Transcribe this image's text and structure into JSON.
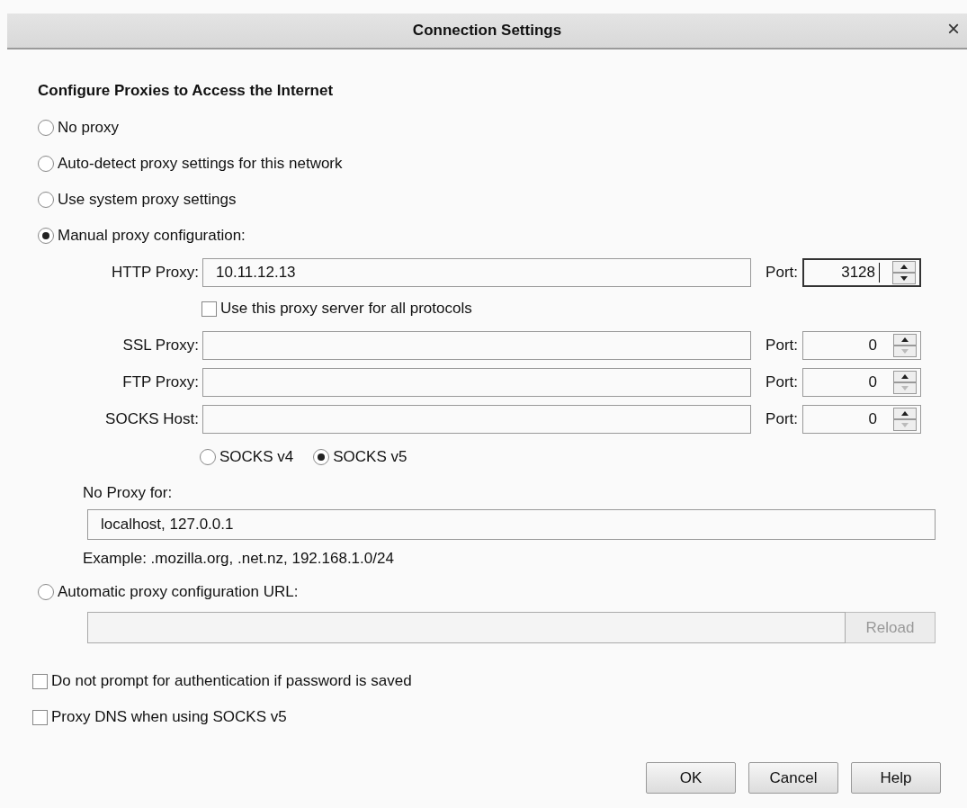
{
  "window": {
    "title": "Connection Settings",
    "close": "×"
  },
  "heading": "Configure Proxies to Access the Internet",
  "proxy_modes": [
    {
      "label": "No proxy",
      "selected": false
    },
    {
      "label": "Auto-detect proxy settings for this network",
      "selected": false
    },
    {
      "label": "Use system proxy settings",
      "selected": false
    },
    {
      "label": "Manual proxy configuration:",
      "selected": true
    }
  ],
  "manual": {
    "http": {
      "label": "HTTP Proxy:",
      "value": "10.11.12.13",
      "port_label": "Port:",
      "port": "3128",
      "focused": true,
      "down_disabled": false
    },
    "share_all": {
      "label": "Use this proxy server for all protocols",
      "checked": false
    },
    "other_proxies": [
      {
        "label": "SSL Proxy:",
        "port_label": "Port:",
        "port": "0",
        "focused": false,
        "down_disabled": true
      },
      {
        "label": "FTP Proxy:",
        "port_label": "Port:",
        "port": "0",
        "focused": false,
        "down_disabled": true
      },
      {
        "label": "SOCKS Host:",
        "port_label": "Port:",
        "port": "0",
        "focused": false,
        "down_disabled": true
      }
    ],
    "socks_versions": [
      {
        "label": "SOCKS v4",
        "selected": false
      },
      {
        "label": "SOCKS v5",
        "selected": true
      }
    ],
    "no_proxy": {
      "label": "No Proxy for:",
      "value": "localhost, 127.0.0.1",
      "example": "Example: .mozilla.org, .net.nz, 192.168.1.0/24"
    }
  },
  "auto_config": {
    "label": "Automatic proxy configuration URL:",
    "selected": false,
    "reload": {
      "label": "Reload",
      "disabled": true
    }
  },
  "options": [
    {
      "label": "Do not prompt for authentication if password is saved",
      "checked": false
    },
    {
      "label": "Proxy DNS when using SOCKS v5",
      "checked": false
    }
  ],
  "buttons": [
    {
      "label": "OK"
    },
    {
      "label": "Cancel"
    },
    {
      "label": "Help"
    }
  ]
}
